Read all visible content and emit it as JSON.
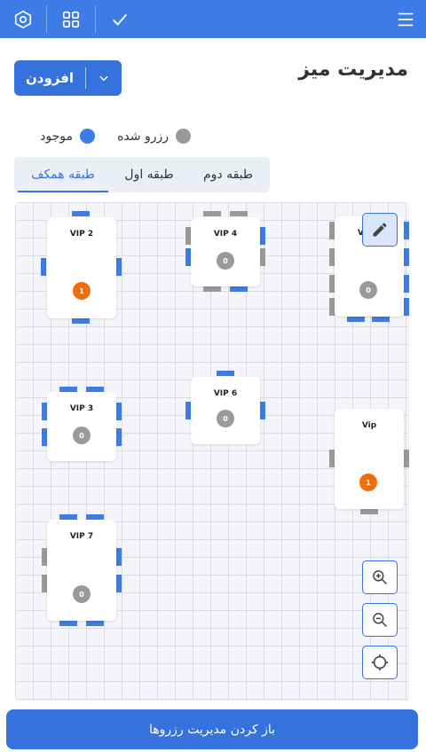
{
  "topbar": {
    "settings_icon": "hexagon-settings-icon",
    "grid_icon": "grid-icon",
    "check_icon": "check-icon",
    "menu_icon": "hamburger-menu-icon"
  },
  "header": {
    "title": "مدیریت میز",
    "add_label": "افزودن"
  },
  "legend": {
    "available_label": "موجود",
    "reserved_label": "رزرو شده",
    "available_color": "#3d7be6",
    "reserved_color": "#999999"
  },
  "tabs": [
    {
      "label": "طبقه همکف",
      "active": true
    },
    {
      "label": "طبقه اول",
      "active": false
    },
    {
      "label": "طبقه دوم",
      "active": false
    }
  ],
  "tables": [
    {
      "name": "VIP 2",
      "count": "1"
    },
    {
      "name": "VIP 4",
      "count": "0"
    },
    {
      "name": "VIP 5",
      "count": "0"
    },
    {
      "name": "VIP 3",
      "count": "0"
    },
    {
      "name": "VIP 6",
      "count": "0"
    },
    {
      "name": "Vip",
      "count": "1"
    },
    {
      "name": "VIP 7",
      "count": "0"
    }
  ],
  "tools": {
    "edit_icon": "pencil-icon",
    "zoom_in_icon": "zoom-in-icon",
    "zoom_out_icon": "zoom-out-icon",
    "recenter_icon": "crosshair-icon"
  },
  "footer": {
    "open_reservations_label": "باز کردن مدیریت رزروها"
  }
}
